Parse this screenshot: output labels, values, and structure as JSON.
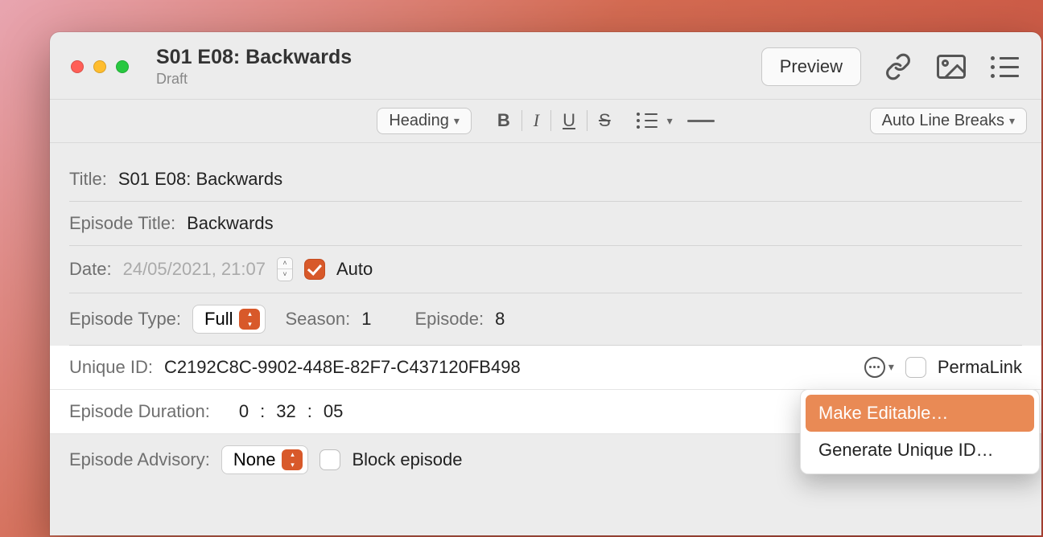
{
  "header": {
    "doc_title": "S01 E08: Backwards",
    "doc_status": "Draft",
    "preview_label": "Preview"
  },
  "toolbar": {
    "heading_label": "Heading",
    "bold": "B",
    "italic": "I",
    "underline": "U",
    "strike": "S",
    "autowrap_label": "Auto Line Breaks"
  },
  "form": {
    "title_label": "Title:",
    "title_value": "S01 E08: Backwards",
    "ep_title_label": "Episode Title:",
    "ep_title_value": "Backwards",
    "date_label": "Date:",
    "date_value": "24/05/2021, 21:07",
    "auto_label": "Auto",
    "ep_type_label": "Episode Type:",
    "ep_type_value": "Full",
    "season_label": "Season:",
    "season_value": "1",
    "episode_label": "Episode:",
    "episode_value": "8",
    "uid_label": "Unique ID:",
    "uid_value": "C2192C8C-9902-448E-82F7-C437120FB498",
    "permalink_label": "PermaLink",
    "duration_label": "Episode Duration:",
    "duration_h": "0",
    "duration_m": "32",
    "duration_s": "05",
    "sep": ":",
    "advisory_label": "Episode Advisory:",
    "advisory_value": "None",
    "block_label": "Block episode"
  },
  "popup": {
    "make_editable": "Make Editable…",
    "generate": "Generate Unique ID…"
  }
}
